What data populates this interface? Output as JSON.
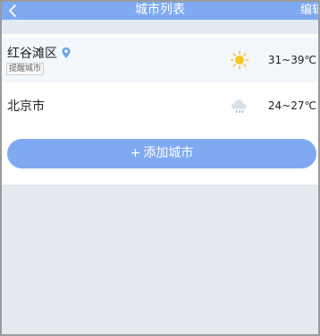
{
  "header": {
    "title": "城市列表",
    "edit_label": "编辑",
    "back_icon": "chevron-left-icon"
  },
  "cities": [
    {
      "name": "红谷滩区",
      "tag": "提醒城市",
      "location_icon": "location-pin-icon",
      "weather_icon": "sunny-icon",
      "temperature": "31~39℃"
    },
    {
      "name": "北京市",
      "weather_icon": "cloud-rain-icon",
      "temperature": "24~27℃"
    }
  ],
  "add_button": {
    "plus": "+",
    "label": "添加城市"
  },
  "colors": {
    "accent": "#7fa9f0",
    "background": "#e3e9ee",
    "sun": "#f7c51e"
  }
}
